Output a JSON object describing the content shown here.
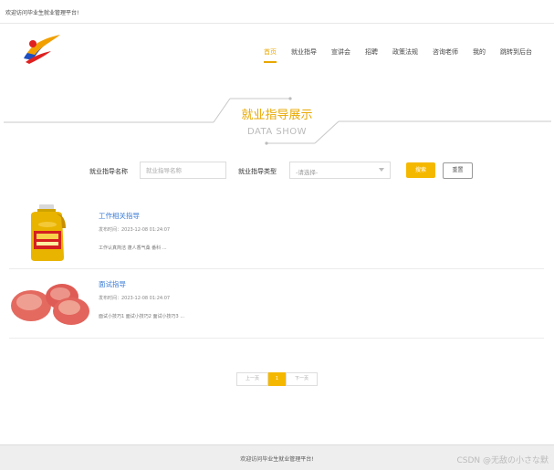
{
  "topbar": {
    "welcome": "欢迎访问毕业生就业管理平台!"
  },
  "nav": {
    "items": [
      {
        "label": "首页",
        "active": true
      },
      {
        "label": "就业指导",
        "active": false
      },
      {
        "label": "宣讲会",
        "active": false
      },
      {
        "label": "招聘",
        "active": false
      },
      {
        "label": "政策法规",
        "active": false
      },
      {
        "label": "咨询老师",
        "active": false
      },
      {
        "label": "我的",
        "active": false
      },
      {
        "label": "跳转到后台",
        "active": false
      }
    ]
  },
  "section": {
    "title_cn": "就业指导展示",
    "title_en": "DATA SHOW"
  },
  "search": {
    "name_label": "就业指导名称",
    "name_placeholder": "就业指导名称",
    "type_label": "就业指导类型",
    "type_selected": "-请选择-",
    "search_button": "搜索",
    "reset_button": "重置"
  },
  "list": [
    {
      "title": "工作相关指导",
      "time": "发布时间：2023-12-08 01:24:07",
      "desc": "工作认真简洁 蓬人香气桑 番科 ...",
      "thumb": "oil-bottle"
    },
    {
      "title": "面试指导",
      "time": "发布时间：2023-12-08 01:24:07",
      "desc": "面试小技巧1 面试小技巧2 面试小技巧3 ...",
      "thumb": "apples"
    }
  ],
  "pager": {
    "prev": "上一页",
    "current": "1",
    "next": "下一页"
  },
  "footer": {
    "text": "欢迎访问毕业生就业管理平台!"
  },
  "watermark": "CSDN @无敌の小さな默",
  "colors": {
    "accent": "#f5b800",
    "link": "#3a7bd5"
  }
}
